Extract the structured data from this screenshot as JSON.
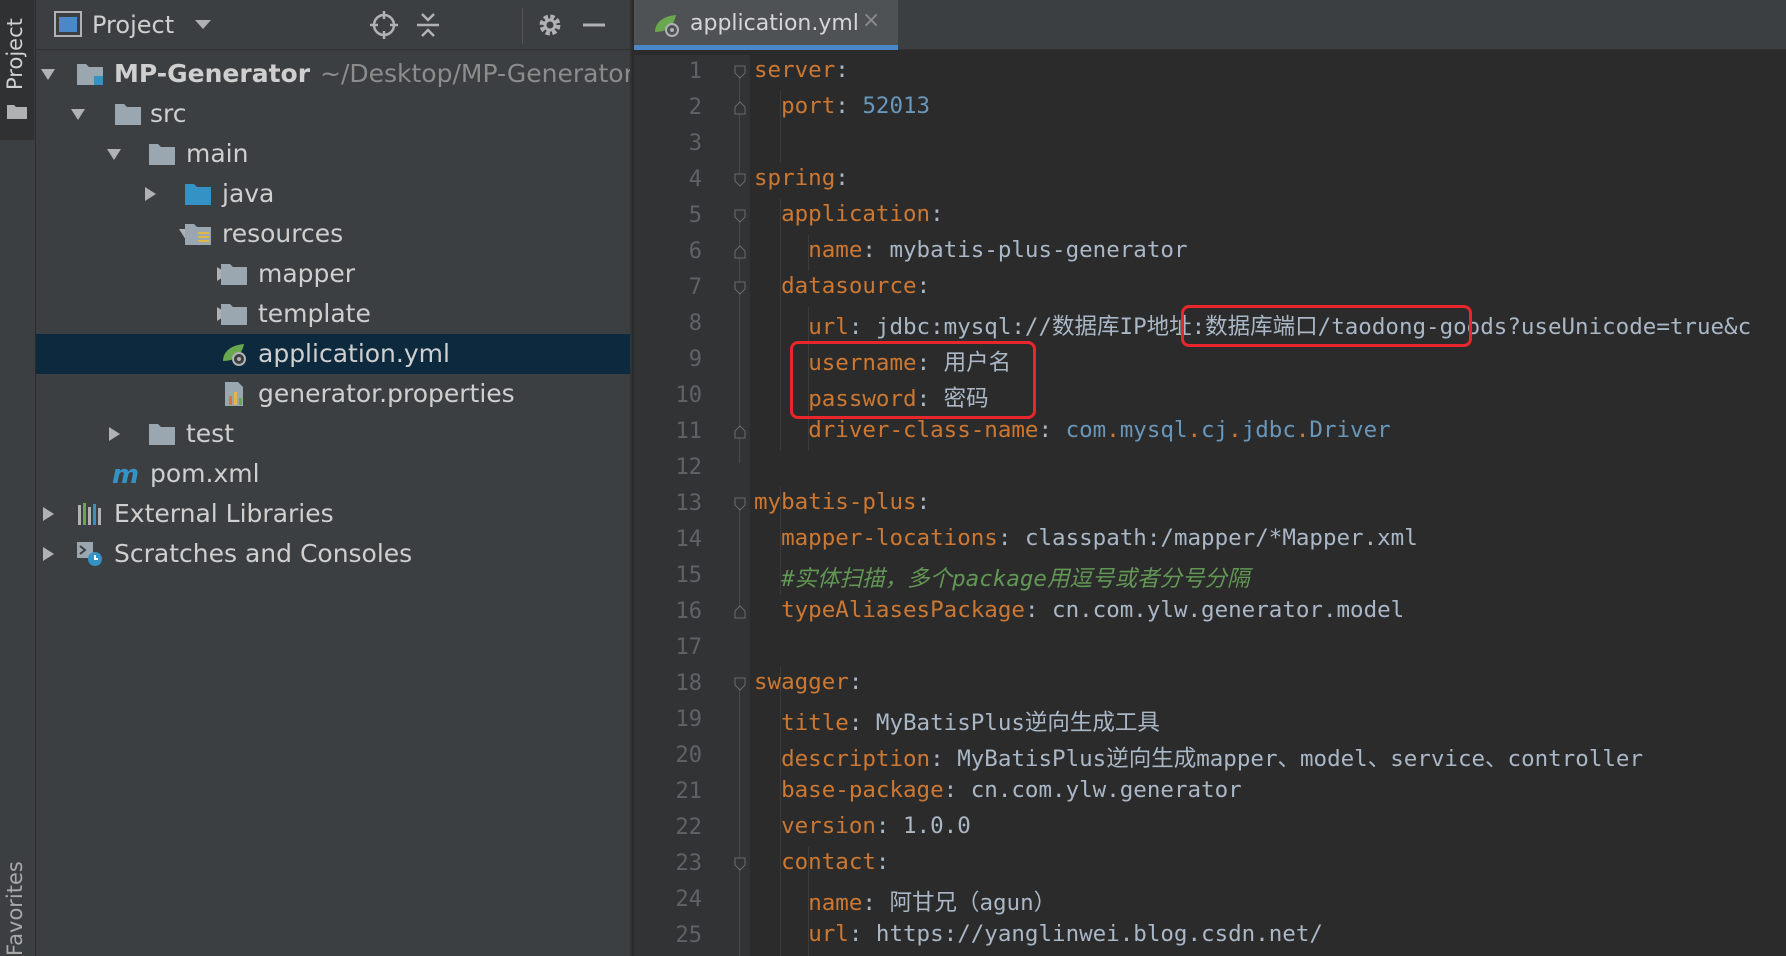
{
  "tool_strip": {
    "project_label": "Project",
    "favorites_label": "Favorites"
  },
  "project_panel": {
    "title": "Project",
    "tree": [
      {
        "label": "MP-Generator",
        "path": "~/Desktop/MP-Generator",
        "kind": "module-icon"
      },
      {
        "label": "src",
        "kind": "folder-icon"
      },
      {
        "label": "main",
        "kind": "folder-icon"
      },
      {
        "label": "java",
        "kind": "source-folder-icon"
      },
      {
        "label": "resources",
        "kind": "resources-folder-icon"
      },
      {
        "label": "mapper",
        "kind": "folder-icon"
      },
      {
        "label": "template",
        "kind": "folder-icon"
      },
      {
        "label": "application.yml",
        "kind": "spring-yml-icon",
        "selected": true
      },
      {
        "label": "generator.properties",
        "kind": "properties-icon"
      },
      {
        "label": "test",
        "kind": "folder-icon"
      },
      {
        "label": "pom.xml",
        "kind": "maven-icon"
      },
      {
        "label": "External Libraries",
        "kind": "libraries-icon"
      },
      {
        "label": "Scratches and Consoles",
        "kind": "scratches-icon"
      }
    ]
  },
  "editor": {
    "tab_label": "application.yml",
    "tab_close": "×",
    "line_numbers": [
      "1",
      "2",
      "3",
      "4",
      "5",
      "6",
      "7",
      "8",
      "9",
      "10",
      "11",
      "12",
      "13",
      "14",
      "15",
      "16",
      "17",
      "18",
      "19",
      "20",
      "21",
      "22",
      "23",
      "24",
      "25"
    ],
    "lines": {
      "l1_key": "server",
      "l2_key": "port",
      "l2_val": "52013",
      "l4_key": "spring",
      "l5_key": "application",
      "l6_key": "name",
      "l6_val": "mybatis-plus-generator",
      "l7_key": "datasource",
      "l8_key": "url",
      "l8_val_a": "jdbc:mysql://",
      "l8_val_b": "数据库IP地址:数据库端口",
      "l8_val_c": "/taodong-goods?useUnicode=true&c",
      "l9_key": "username",
      "l9_val": "用户名",
      "l10_key": "password",
      "l10_val": "密码",
      "l11_key": "driver-class-name",
      "l11_v1": "com",
      "l11_v2": "mysql",
      "l11_v3": "cj",
      "l11_v4": "jdbc",
      "l11_v5": "Driver",
      "l13_key": "mybatis-plus",
      "l14_key": "mapper-locations",
      "l14_val": "classpath:/mapper/*Mapper.xml",
      "l15_comment": "#实体扫描，多个package用逗号或者分号分隔",
      "l16_key": "typeAliasesPackage",
      "l16_val": "cn.com.ylw.generator.model",
      "l18_key": "swagger",
      "l19_key": "title",
      "l19_val": "MyBatisPlus逆向生成工具",
      "l20_key": "description",
      "l20_val": "MyBatisPlus逆向生成mapper、model、service、controller",
      "l21_key": "base-package",
      "l21_val": "cn.com.ylw.generator",
      "l22_key": "version",
      "l22_val": "1.0.0",
      "l23_key": "contact",
      "l24_key": "name",
      "l24_val": "阿甘兄（agun）",
      "l25_key": "url",
      "l25_val": "https://yanglinwei.blog.csdn.net/"
    }
  },
  "colors": {
    "highlight_box": "#e8262b",
    "key": "#cc7832",
    "number": "#6897bb",
    "comment": "#629755",
    "selection": "#0d293e"
  }
}
